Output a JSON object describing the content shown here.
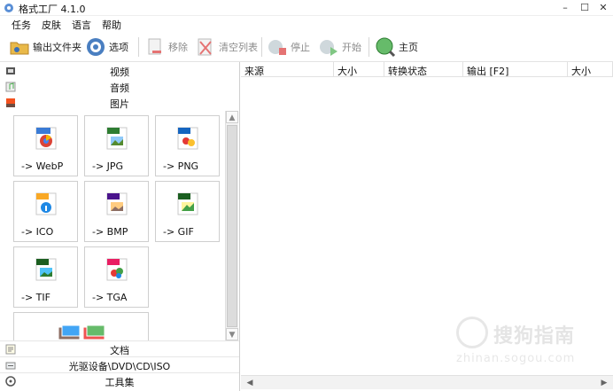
{
  "window": {
    "title": "格式工厂 4.1.0",
    "minimize": "–",
    "maximize": "☐",
    "close": "✕"
  },
  "menu": [
    "任务",
    "皮肤",
    "语言",
    "帮助"
  ],
  "toolbar": {
    "output_folder": "输出文件夹",
    "options": "选项",
    "remove": "移除",
    "clear_list": "清空列表",
    "stop": "停止",
    "start": "开始",
    "home": "主页"
  },
  "categories_top": [
    {
      "label": "视频",
      "icon": "video-icon"
    },
    {
      "label": "音频",
      "icon": "audio-icon"
    },
    {
      "label": "图片",
      "icon": "picture-icon"
    }
  ],
  "image_formats": [
    {
      "label": "-> WebP",
      "badge": "WebP",
      "color": "#3a7bd5"
    },
    {
      "label": "-> JPG",
      "badge": "JPG",
      "color": "#2e7d32"
    },
    {
      "label": "-> PNG",
      "badge": "PNG",
      "color": "#1565c0"
    },
    {
      "label": "-> ICO",
      "badge": "ICO",
      "color": "#f9a825"
    },
    {
      "label": "-> BMP",
      "badge": "BMP",
      "color": "#4a148c"
    },
    {
      "label": "-> GIF",
      "badge": "GIF",
      "color": "#1b5e20"
    },
    {
      "label": "-> TIF",
      "badge": "TIF",
      "color": "#1b5e20"
    },
    {
      "label": "-> TGA",
      "badge": "TGA",
      "color": "#e91e63"
    }
  ],
  "categories_bottom": [
    {
      "label": "文档",
      "icon": "document-icon"
    },
    {
      "label": "光驱设备\\DVD\\CD\\ISO",
      "icon": "optical-drive-icon"
    },
    {
      "label": "工具集",
      "icon": "toolbox-icon"
    }
  ],
  "task_columns": [
    "来源",
    "大小",
    "转换状态",
    "输出 [F2]",
    "大小"
  ],
  "watermark": {
    "text": "搜狗指南",
    "sub": "zhinan.sogou.com"
  }
}
